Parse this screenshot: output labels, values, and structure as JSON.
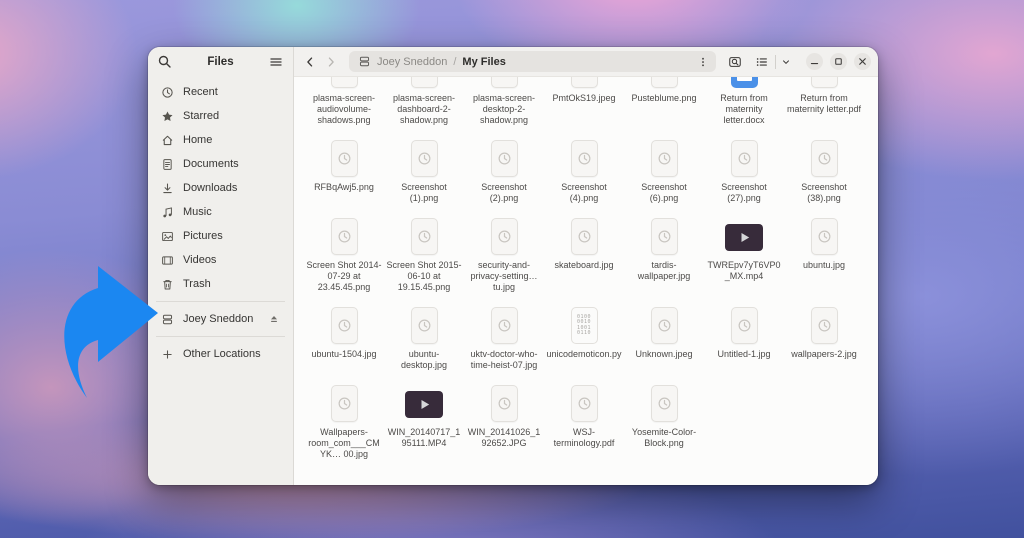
{
  "colors": {
    "arrow": "#1b87f1",
    "docx_icon": "#4a90e8",
    "video_thumb": "#372b3a",
    "accent": "#3584e4"
  },
  "sidebar": {
    "title": "Files",
    "items": [
      {
        "icon": "clock-icon",
        "label": "Recent"
      },
      {
        "icon": "star-icon",
        "label": "Starred"
      },
      {
        "icon": "home-icon",
        "label": "Home"
      },
      {
        "icon": "document-icon",
        "label": "Documents"
      },
      {
        "icon": "download-icon",
        "label": "Downloads"
      },
      {
        "icon": "music-icon",
        "label": "Music"
      },
      {
        "icon": "picture-icon",
        "label": "Pictures"
      },
      {
        "icon": "film-icon",
        "label": "Videos"
      },
      {
        "icon": "trash-icon",
        "label": "Trash"
      }
    ],
    "device": {
      "icon": "drive-icon",
      "label": "Joey Sneddon"
    },
    "other_locations": {
      "icon": "plus-icon",
      "label": "Other Locations"
    }
  },
  "header": {
    "breadcrumb": {
      "root": "Joey Sneddon",
      "separator": "/",
      "current": "My Files"
    }
  },
  "files": {
    "code_icon_lines": "0100\n0010\n1001\n0110",
    "grid": [
      {
        "name": "plasma-screen-audiovolume-shadows.png",
        "icon": "thumbnail-pending-icon"
      },
      {
        "name": "plasma-screen-dashboard-2-shadow.png",
        "icon": "thumbnail-pending-icon"
      },
      {
        "name": "plasma-screen-desktop-2-shadow.png",
        "icon": "thumbnail-pending-icon"
      },
      {
        "name": "PmtOkS19.jpeg",
        "icon": "thumbnail-pending-icon"
      },
      {
        "name": "Pusteblume.png",
        "icon": "thumbnail-pending-icon"
      },
      {
        "name": "Return from maternity letter.docx",
        "icon": "docx-icon"
      },
      {
        "name": "Return from maternity letter.pdf",
        "icon": "thumbnail-pending-icon"
      },
      {
        "name": "RFBqAwj5.png",
        "icon": "thumbnail-pending-icon"
      },
      {
        "name": "Screenshot (1).png",
        "icon": "thumbnail-pending-icon"
      },
      {
        "name": "Screenshot (2).png",
        "icon": "thumbnail-pending-icon"
      },
      {
        "name": "Screenshot (4).png",
        "icon": "thumbnail-pending-icon"
      },
      {
        "name": "Screenshot (6).png",
        "icon": "thumbnail-pending-icon"
      },
      {
        "name": "Screenshot (27).png",
        "icon": "thumbnail-pending-icon"
      },
      {
        "name": "Screenshot (38).png",
        "icon": "thumbnail-pending-icon"
      },
      {
        "name": "Screen Shot 2014-07-29 at 23.45.45.png",
        "icon": "thumbnail-pending-icon"
      },
      {
        "name": "Screen Shot 2015-06-10 at 19.15.45.png",
        "icon": "thumbnail-pending-icon"
      },
      {
        "name": "security-and-privacy-setting…tu.jpg",
        "icon": "thumbnail-pending-icon"
      },
      {
        "name": "skateboard.jpg",
        "icon": "thumbnail-pending-icon"
      },
      {
        "name": "tardis-wallpaper.jpg",
        "icon": "thumbnail-pending-icon"
      },
      {
        "name": "TWREpv7yT6VP0_MX.mp4",
        "icon": "video-thumb-icon"
      },
      {
        "name": "ubuntu.jpg",
        "icon": "thumbnail-pending-icon"
      },
      {
        "name": "ubuntu-1504.jpg",
        "icon": "thumbnail-pending-icon"
      },
      {
        "name": "ubuntu-desktop.jpg",
        "icon": "thumbnail-pending-icon"
      },
      {
        "name": "uktv-doctor-who-time-heist-07.jpg",
        "icon": "thumbnail-pending-icon"
      },
      {
        "name": "unicodemoticon.py",
        "icon": "python-code-icon"
      },
      {
        "name": "Unknown.jpeg",
        "icon": "thumbnail-pending-icon"
      },
      {
        "name": "Untitled-1.jpg",
        "icon": "thumbnail-pending-icon"
      },
      {
        "name": "wallpapers-2.jpg",
        "icon": "thumbnail-pending-icon"
      },
      {
        "name": "Wallpapers-room_com___CMYK… 00.jpg",
        "icon": "thumbnail-pending-icon"
      },
      {
        "name": "WIN_20140717_195111.MP4",
        "icon": "video-thumb-icon"
      },
      {
        "name": "WIN_20141026_192652.JPG",
        "icon": "thumbnail-pending-icon"
      },
      {
        "name": "WSJ-terminology.pdf",
        "icon": "thumbnail-pending-icon"
      },
      {
        "name": "Yosemite-Color-Block.png",
        "icon": "thumbnail-pending-icon"
      }
    ]
  }
}
